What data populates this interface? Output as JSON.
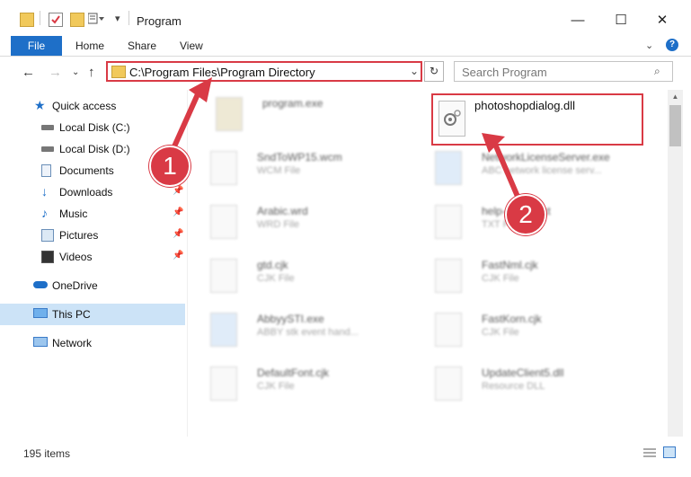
{
  "window": {
    "title": "Program",
    "minimize_glyph": "—",
    "maximize_glyph": "☐",
    "close_glyph": "✕"
  },
  "ribbon": {
    "tabs": [
      "File",
      "Home",
      "Share",
      "View"
    ],
    "help_glyph": "?"
  },
  "nav": {
    "address": "C:\\Program Files\\Program Directory",
    "search_placeholder": "Search Program"
  },
  "sidebar": {
    "items": [
      {
        "label": "Quick access",
        "icon": "star-icon"
      },
      {
        "label": "Local Disk (C:)",
        "icon": "drive-icon"
      },
      {
        "label": "Local Disk (D:)",
        "icon": "drive-icon"
      },
      {
        "label": "Documents",
        "icon": "documents-icon"
      },
      {
        "label": "Downloads",
        "icon": "download-icon"
      },
      {
        "label": "Music",
        "icon": "music-icon"
      },
      {
        "label": "Pictures",
        "icon": "pictures-icon"
      },
      {
        "label": "Videos",
        "icon": "videos-icon"
      },
      {
        "label": "OneDrive",
        "icon": "cloud-icon"
      },
      {
        "label": "This PC",
        "icon": "computer-icon"
      },
      {
        "label": "Network",
        "icon": "network-icon"
      }
    ]
  },
  "files": [
    {
      "name": "program.exe",
      "type": ""
    },
    {
      "name": "photoshopdialog.dll",
      "type": ""
    },
    {
      "name": "SndToWP15.wcm",
      "type": "WCM File"
    },
    {
      "name": "NetworkLicenseServer.exe",
      "type": "ABC network license serv..."
    },
    {
      "name": "Arabic.wrd",
      "type": "WRD File"
    },
    {
      "name": "help-reader.txt",
      "type": "TXT File"
    },
    {
      "name": "gtd.cjk",
      "type": "CJK File"
    },
    {
      "name": "FastNml.cjk",
      "type": "CJK File"
    },
    {
      "name": "AbbyySTI.exe",
      "type": "ABBY stk event hand..."
    },
    {
      "name": "FastKorn.cjk",
      "type": "CJK File"
    },
    {
      "name": "DefaultFont.cjk",
      "type": "CJK File"
    },
    {
      "name": "UpdateClient5.dll",
      "type": "Resource DLL"
    }
  ],
  "status": {
    "item_count": "195 items"
  },
  "callouts": [
    "1",
    "2"
  ],
  "colors": {
    "accent": "#1e6fc8",
    "highlight": "#d93a45",
    "selected_nav": "#cce3f7"
  }
}
